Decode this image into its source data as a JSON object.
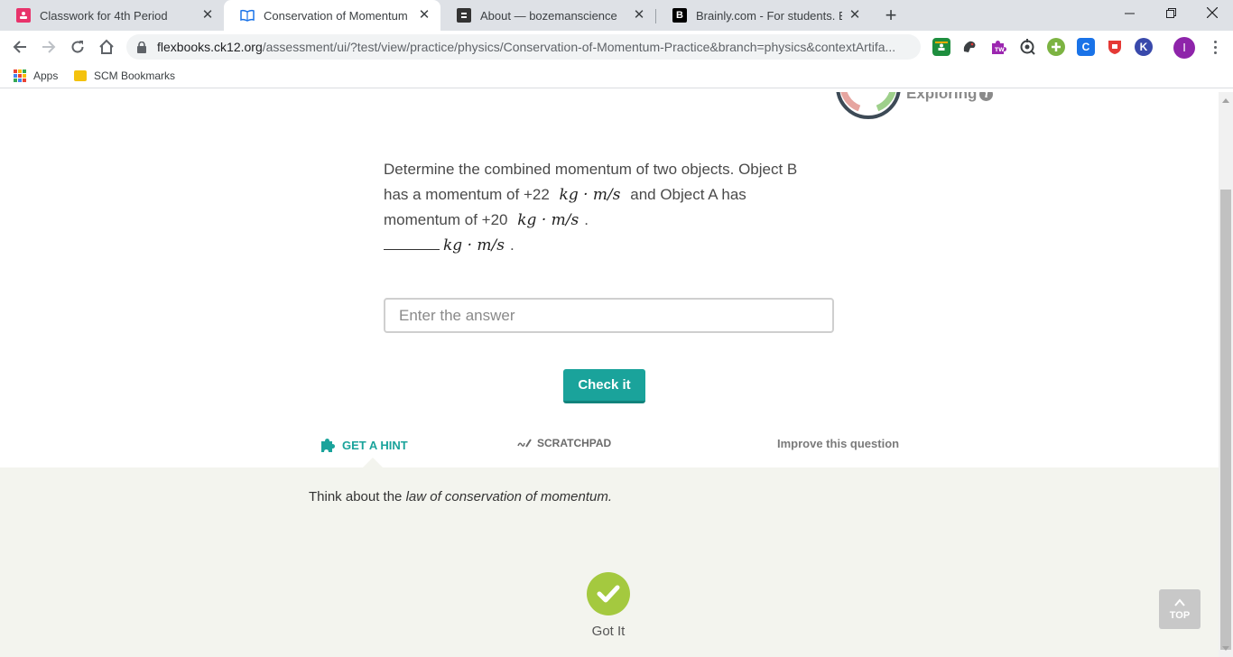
{
  "browser": {
    "tabs": [
      {
        "title": "Classwork for 4th Period",
        "favicon_color": "#e8336b",
        "active": false
      },
      {
        "title": "Conservation of Momentum Practice",
        "favicon_color": "#1a73e8",
        "active": true
      },
      {
        "title": "About — bozemanscience",
        "favicon_color": "#333333",
        "active": false
      },
      {
        "title": "Brainly.com - For students. By students.",
        "favicon_color": "#000000",
        "favicon_letter": "B",
        "active": false
      }
    ],
    "address": {
      "host": "flexbooks.ck12.org",
      "path": "/assessment/ui/?test/view/practice/physics/Conservation-of-Momentum-Practice&branch=physics&contextArtifa..."
    },
    "profile_initial": "I",
    "extensions": [
      {
        "name": "google-classroom-icon",
        "color": "#1e8e3e"
      },
      {
        "name": "ext-silhouette-icon",
        "color": "#5f6368"
      },
      {
        "name": "ext-puzzle-icon",
        "color": "#9c27b0"
      },
      {
        "name": "ext-target-icon",
        "color": "#3c4043"
      },
      {
        "name": "ext-plus-icon",
        "color": "#7cb342"
      },
      {
        "name": "ext-c-icon",
        "color": "#1a73e8",
        "letter": "C"
      },
      {
        "name": "ext-shield-icon",
        "color": "#e53935"
      },
      {
        "name": "ext-k-icon",
        "color": "#3949ab",
        "letter": "K"
      }
    ]
  },
  "bookmarks": {
    "apps_label": "Apps",
    "folder_label": "SCM Bookmarks"
  },
  "practice": {
    "mastery_label": "Exploring",
    "question": {
      "line1": "Determine the combined momentum of two objects. Object B",
      "line2_pre": "has a momentum of +22",
      "unit": "kg · m/s",
      "line2_post": "and Object A has",
      "line3_pre": "momentum of +20",
      "end_period": "."
    },
    "answer_placeholder": "Enter the answer",
    "check_label": "Check it",
    "tools": {
      "hint_label": "GET A HINT",
      "scratchpad_label": "SCRATCHPAD",
      "improve_label": "Improve this question"
    },
    "hint_prefix": "Think about the ",
    "hint_emphasis": "law of conservation of momentum.",
    "got_it_label": "Got It",
    "top_label": "TOP",
    "colors": {
      "accent": "#1aa39b",
      "got_it": "#a4c93f",
      "hint_panel": "#f3f4ee"
    }
  }
}
